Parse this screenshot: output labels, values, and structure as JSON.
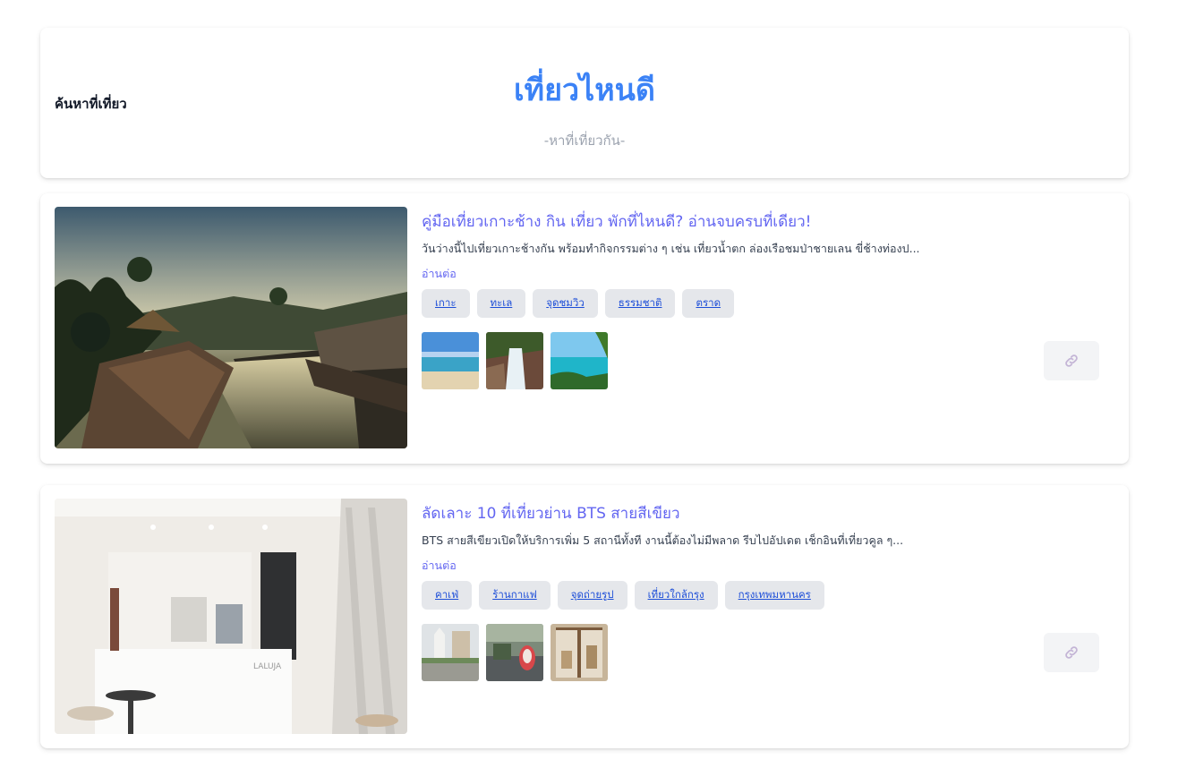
{
  "header": {
    "title": "เที่ยวไหนดี",
    "search_label": "ค้นหาที่เที่ยว",
    "search_placeholder": "-หาที่เที่ยวกัน-"
  },
  "posts": [
    {
      "title": "คู่มือเที่ยวเกาะช้าง กิน เที่ยว พักที่ไหนดี? อ่านจบครบที่เดียว!",
      "excerpt": "วันว่างนี้ไปเที่ยวเกาะช้างกัน พร้อมทำกิจกรรมต่าง ๆ เช่น เที่ยวน้ำตก ล่องเรือชมป่าชายเลน ขี่ช้างท่องป...",
      "read_more": "อ่านต่อ",
      "tags": [
        "เกาะ",
        "ทะเล",
        "จุดชมวิว",
        "ธรรมชาติ",
        "ตราด"
      ],
      "image": "resort-pool-photo",
      "thumbnails": [
        "beach-photo",
        "waterfall-photo",
        "island-sea-photo"
      ],
      "link_icon": "link-icon"
    },
    {
      "title": "ลัดเลาะ 10 ที่เที่ยวย่าน BTS สายสีเขียว",
      "excerpt": "BTS สายสีเขียวเปิดให้บริการเพิ่ม 5 สถานีทั้งที งานนี้ต้องไม่มีพลาด รีบไปอัปเดต เช็กอินที่เที่ยวคูล ๆ...",
      "read_more": "อ่านต่อ",
      "tags": [
        "คาเฟ่",
        "ร้านกาแฟ",
        "จุดถ่ายรูป",
        "เที่ยวใกล้กรุง",
        "กรุงเทพมหานคร"
      ],
      "image": "cafe-interior-photo",
      "cafe_sign": "LALUJA",
      "thumbnails": [
        "city-street-photo",
        "temple-decor-photo",
        "cafe-shop-photo"
      ],
      "link_icon": "link-icon"
    }
  ],
  "colors": {
    "title": "#3b82f6",
    "post_title": "#6366f1",
    "tag_bg": "#e5e7eb",
    "tag_text": "#1d4ed8"
  }
}
